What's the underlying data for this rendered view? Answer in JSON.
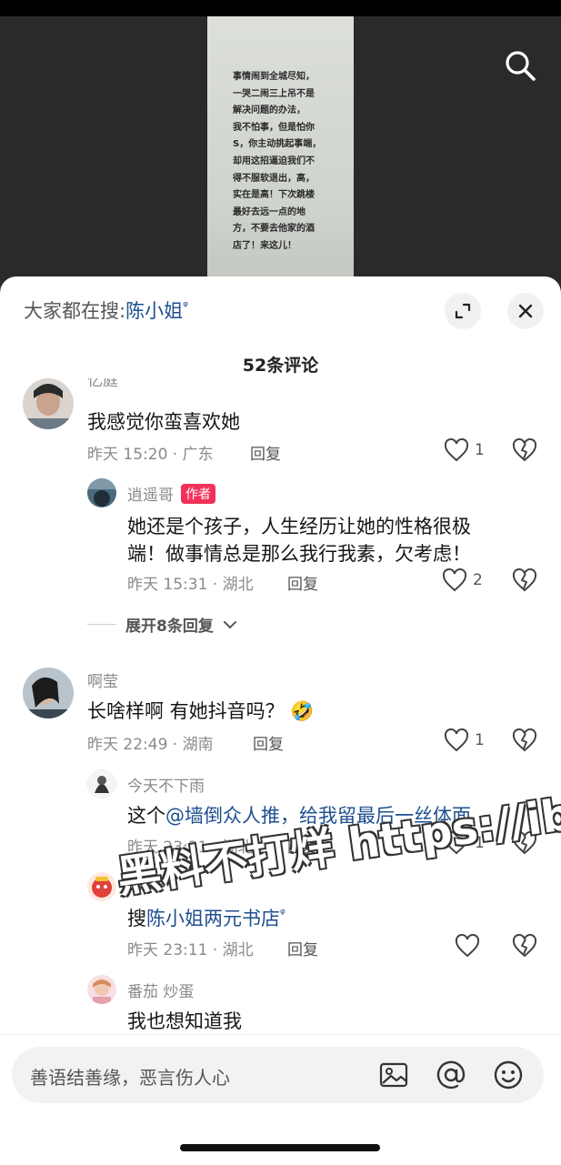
{
  "video": {
    "caption": "事情闹到全城尽知，\n一哭二闹三上吊不是\n解决问题的办法，\n我不怕事，但是怕你\nS，你主动挑起事端，\n却用这招逼迫我们不\n得不服软退出，高，\n实在是高！下次跳楼\n最好去远一点的地\n方，不要去他家的酒\n店了！来这儿！",
    "search_icon": "search-icon"
  },
  "sheet": {
    "search_prefix": "大家都在搜:",
    "search_term": "陈小姐",
    "comment_count": "52条评论"
  },
  "comments": [
    {
      "username": "忆庭",
      "text": "我感觉你蛮喜欢她",
      "time_location": "昨天 15:20 · 广东",
      "reply_label": "回复",
      "likes": "1",
      "replies": [
        {
          "username": "逍遥哥",
          "badge": "作者",
          "text_line1": "她还是个孩子，人生经历让她的性格很极",
          "text_line2": "端！做事情总是那么我行我素，欠考虑！",
          "time_location": "昨天 15:31 · 湖北",
          "reply_label": "回复",
          "likes": "2"
        }
      ],
      "expand_label": "展开8条回复"
    },
    {
      "username": "啊莹",
      "text": "长啥样啊 有她抖音吗？",
      "emoji": "🤣",
      "time_location": "昨天 22:49 · 湖南",
      "reply_label": "回复",
      "likes": "1",
      "replies": [
        {
          "username": "今天不下雨",
          "text_prefix": "这个",
          "mention": "@墙倒众人推，给我留最后一丝体面",
          "time_location": "昨天 23:31 · 湖北",
          "reply_label": "回复",
          "likes": "1"
        },
        {
          "username": "futu",
          "text_prefix": "搜",
          "search_link": "陈小姐两元书店",
          "time_location": "昨天 23:11 · 湖北",
          "reply_label": "回复",
          "likes": ""
        },
        {
          "username": "番茄 炒蛋",
          "text": "我也想知道我"
        }
      ]
    }
  ],
  "watermark": "黑料不打烊 https://ibdy29.com",
  "input": {
    "placeholder": "善语结善缘，恶言伤人心"
  }
}
